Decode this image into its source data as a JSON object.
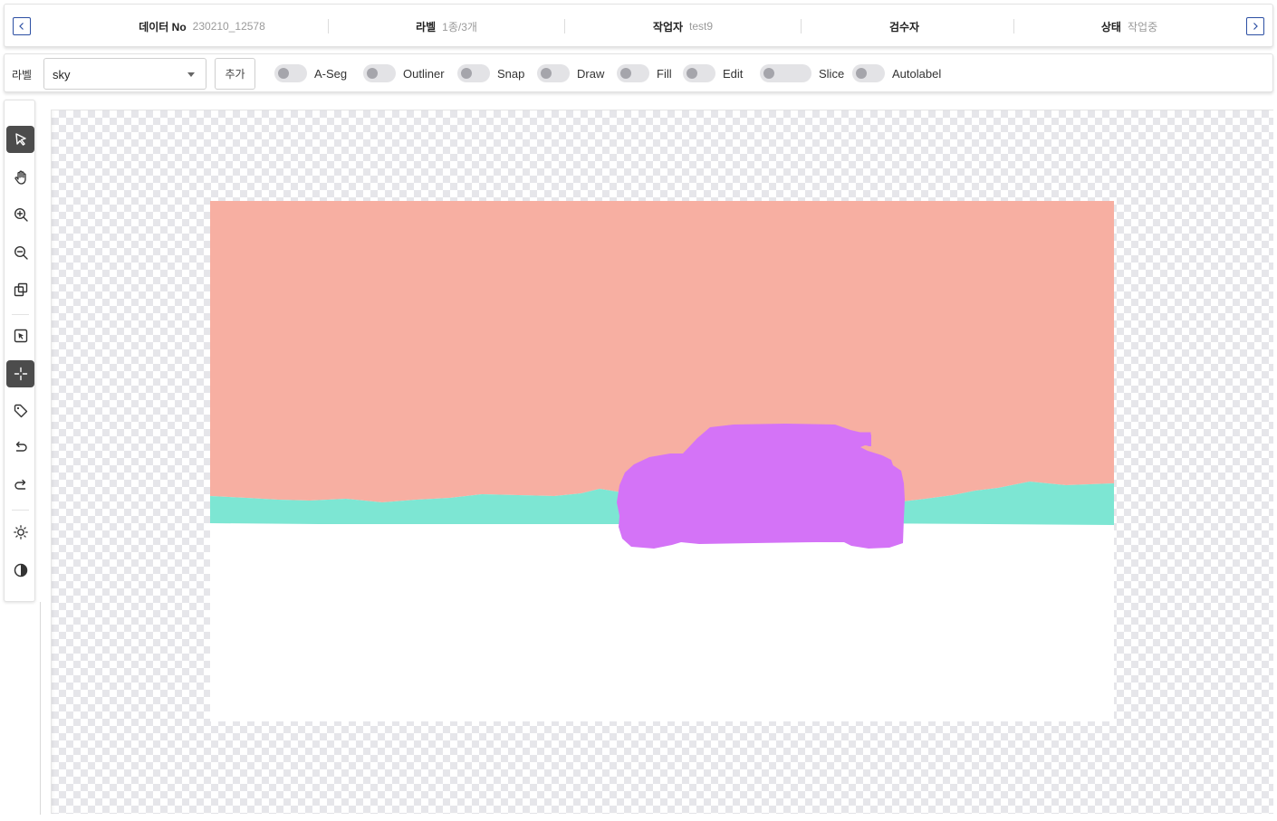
{
  "header": {
    "data_no_label": "데이터 No",
    "data_no_value": "230210_12578",
    "label_label": "라벨",
    "label_value": "1종/3개",
    "worker_label": "작업자",
    "worker_value": "test9",
    "reviewer_label": "검수자",
    "reviewer_value": "",
    "status_label": "상태",
    "status_value": "작업중",
    "prev_icon": "chevron-left-icon",
    "next_icon": "chevron-right-icon",
    "nav_color": "#2c4fa3"
  },
  "toolbar": {
    "label_caption": "라벨",
    "label_select_value": "sky",
    "add_button_label": "추가",
    "toggles": [
      {
        "label": "A-Seg",
        "on": false
      },
      {
        "label": "Outliner",
        "on": false
      },
      {
        "label": "Snap",
        "on": false
      },
      {
        "label": "Draw",
        "on": false
      },
      {
        "label": "Fill",
        "on": false
      },
      {
        "label": "Edit",
        "on": false
      },
      {
        "label": "Slice",
        "on": false
      },
      {
        "label": "Autolabel",
        "on": false
      }
    ]
  },
  "tools": [
    {
      "name": "select-arrow-icon",
      "active": true
    },
    {
      "name": "pan-hand-icon",
      "active": false
    },
    {
      "name": "zoom-in-icon",
      "active": false
    },
    {
      "name": "zoom-out-icon",
      "active": false
    },
    {
      "name": "copy-layers-icon",
      "active": false
    },
    {
      "name": "box-select-icon",
      "active": false
    },
    {
      "name": "crosshair-icon",
      "active": true
    },
    {
      "name": "tag-icon",
      "active": false
    },
    {
      "name": "undo-icon",
      "active": false
    },
    {
      "name": "redo-icon",
      "active": false
    },
    {
      "name": "brightness-icon",
      "active": false
    },
    {
      "name": "contrast-icon",
      "active": false
    }
  ],
  "canvas": {
    "segments": [
      {
        "name": "sky",
        "color": "#f7afa2"
      },
      {
        "name": "ground",
        "color": "#7de6d3"
      },
      {
        "name": "car",
        "color": "#d473f7"
      },
      {
        "name": "road",
        "color": "#ffffff"
      }
    ]
  }
}
